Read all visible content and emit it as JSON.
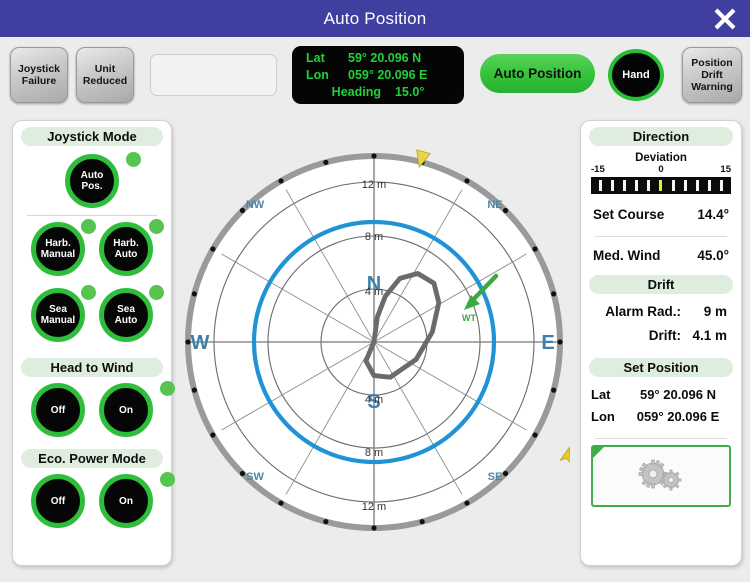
{
  "window": {
    "title": "Auto Position",
    "close_icon": "close-icon"
  },
  "toolbar": {
    "joystick_failure": "Joystick\nFailure",
    "joystick_failure_l1": "Joystick",
    "joystick_failure_l2": "Failure",
    "unit_reduced_l1": "Unit",
    "unit_reduced_l2": "Reduced",
    "position_drift_l1": "Position",
    "position_drift_l2": "Drift",
    "position_drift_l3": "Warning",
    "auto_position": "Auto Position",
    "hand": "Hand",
    "lcd": {
      "lat_label": "Lat",
      "lat_value": "59° 20.096 N",
      "lon_label": "Lon",
      "lon_value": "059° 20.096 E",
      "heading_label": "Heading",
      "heading_value": "15.0°"
    }
  },
  "left_panel": {
    "joystick_mode": {
      "title": "Joystick Mode",
      "auto_pos_l1": "Auto",
      "auto_pos_l2": "Pos.",
      "harb_manual_l1": "Harb.",
      "harb_manual_l2": "Manual",
      "harb_auto_l1": "Harb.",
      "harb_auto_l2": "Auto",
      "sea_manual_l1": "Sea",
      "sea_manual_l2": "Manual",
      "sea_auto_l1": "Sea",
      "sea_auto_l2": "Auto"
    },
    "head_to_wind": {
      "title": "Head to Wind",
      "off": "Off",
      "on": "On"
    },
    "eco_power_mode": {
      "title": "Eco. Power Mode",
      "off": "Off",
      "on": "On"
    }
  },
  "right_panel": {
    "direction": {
      "title": "Direction",
      "deviation_label": "Deviation",
      "scale_min": "-15",
      "scale_mid": "0",
      "scale_max": "15",
      "deviation_value": 0,
      "set_course_label": "Set Course",
      "set_course_value": "14.4°",
      "med_wind_label": "Med. Wind",
      "med_wind_value": "45.0°"
    },
    "drift": {
      "title": "Drift",
      "alarm_rad_label": "Alarm Rad.:",
      "alarm_rad_value": "9 m",
      "drift_label": "Drift:",
      "drift_value": "4.1 m"
    },
    "set_position": {
      "title": "Set Position",
      "lat_label": "Lat",
      "lat_value": "59° 20.096 N",
      "lon_label": "Lon",
      "lon_value": "059° 20.096 E"
    },
    "settings_icon": "gears-icon"
  },
  "radar": {
    "compass_labels": {
      "n": "N",
      "ne": "NE",
      "e": "E",
      "se": "SE",
      "s": "S",
      "sw": "SW",
      "w": "W",
      "nw": "NW"
    },
    "range_rings": [
      "4 m",
      "8 m",
      "12 m"
    ],
    "ring_top_4": "4 m",
    "ring_top_8": "8 m",
    "ring_top_12": "12 m",
    "ring_bot_4": "4 m",
    "ring_bot_8": "8 m",
    "ring_bot_12": "12 m",
    "wind_label": "WT",
    "alarm_radius_m": 9,
    "max_range_m": 14,
    "heading_deg": 15.0,
    "wind_from_deg": 45.0,
    "vessel_marker": "vessel-marker-icon",
    "heading_marker": "heading-marker-icon"
  },
  "colors": {
    "title_bar": "#3f3fa0",
    "green_led": "#57c451",
    "knob_ring": "#2fbe3c",
    "lcd_text": "#21d03a",
    "alarm_circle": "#1f93d6",
    "track": "#6b6b6b",
    "compass_ring": "#9a9a9a",
    "compass_label": "#3f7fa8",
    "wind_arrow": "#3aa93f",
    "vessel_yellow": "#e8c82a",
    "section_header_bg": "#dfedde"
  }
}
